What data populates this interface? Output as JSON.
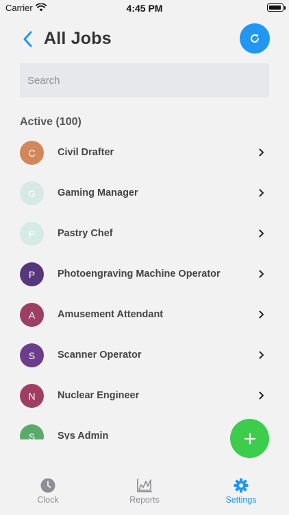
{
  "status_bar": {
    "carrier": "Carrier",
    "time": "4:45 PM"
  },
  "header": {
    "title": "All Jobs",
    "back_icon": "chevron-left-icon",
    "refresh_icon": "refresh-icon"
  },
  "search": {
    "placeholder": "Search",
    "value": ""
  },
  "section": {
    "title": "Active (100)"
  },
  "jobs": [
    {
      "initial": "C",
      "name": "Civil Drafter",
      "color": "#d2875a"
    },
    {
      "initial": "G",
      "name": "Gaming Manager",
      "color": "#d7e9e5"
    },
    {
      "initial": "P",
      "name": "Pastry Chef",
      "color": "#d5ebe6"
    },
    {
      "initial": "P",
      "name": "Photoengraving Machine Operator",
      "color": "#56377b"
    },
    {
      "initial": "A",
      "name": "Amusement Attendant",
      "color": "#9c3f63"
    },
    {
      "initial": "S",
      "name": "Scanner Operator",
      "color": "#6b3d8c"
    },
    {
      "initial": "N",
      "name": "Nuclear Engineer",
      "color": "#a03e62"
    },
    {
      "initial": "S",
      "name": "Sys Admin",
      "color": "#5aab6a"
    }
  ],
  "fab": {
    "icon": "plus-icon"
  },
  "tabs": [
    {
      "label": "Clock",
      "icon": "clock-icon",
      "active": false
    },
    {
      "label": "Reports",
      "icon": "chart-icon",
      "active": false
    },
    {
      "label": "Settings",
      "icon": "gear-icon",
      "active": true
    }
  ],
  "colors": {
    "accent": "#2196f3",
    "fab": "#3ccd4d",
    "background": "#f2f2f2"
  }
}
